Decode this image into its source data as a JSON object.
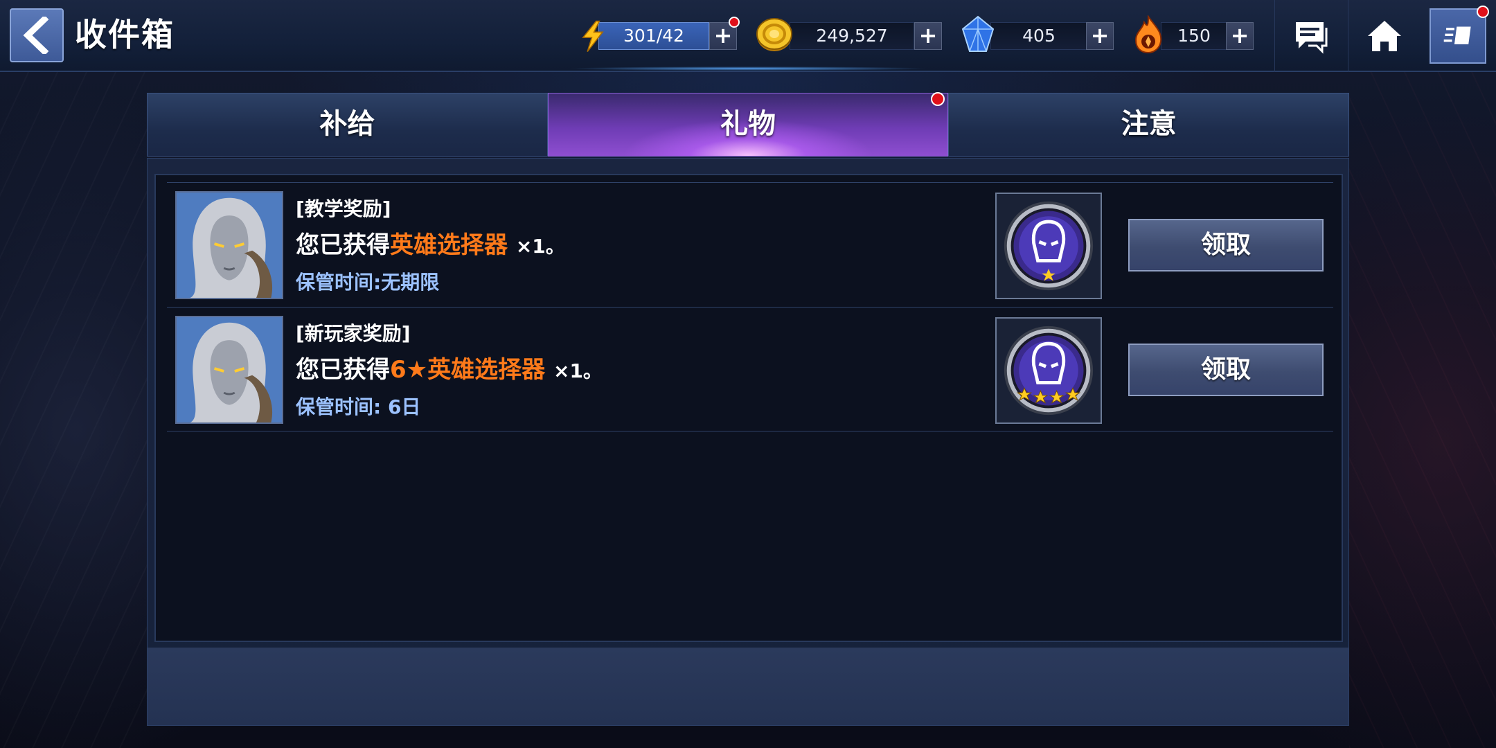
{
  "header": {
    "title": "收件箱",
    "resources": {
      "energy": {
        "value": "301/42",
        "plus": "+"
      },
      "gold": {
        "value": "249,527",
        "plus": "+"
      },
      "crystal": {
        "value": "405",
        "plus": "+"
      },
      "fire": {
        "value": "150",
        "plus": "+"
      }
    },
    "icons": [
      "back-arrow-icon",
      "lightning-icon",
      "gold-coin-icon",
      "crystal-icon",
      "flame-icon",
      "chat-icon",
      "home-icon",
      "menu-icon"
    ]
  },
  "tabs": [
    {
      "label": "补给",
      "active": false
    },
    {
      "label": "礼物",
      "active": true
    },
    {
      "label": "注意",
      "active": false
    }
  ],
  "messages": [
    {
      "tag": "[教学奖励]",
      "prefix": "您已获得",
      "item": "英雄选择器",
      "qty": "×1。",
      "keep": "保管时间:无期限",
      "reward_stars": 1,
      "button": "领取"
    },
    {
      "tag": "[新玩家奖励]",
      "prefix": "您已获得",
      "item": "6★英雄选择器",
      "qty": "×1。",
      "keep": "保管时间: 6日",
      "reward_stars": 4,
      "button": "领取"
    }
  ],
  "colors": {
    "highlight": "#ff7a1a",
    "keep_text": "#9cc2ff",
    "notify_dot": "#e0101a",
    "active_tab": "#8e4ed0"
  }
}
